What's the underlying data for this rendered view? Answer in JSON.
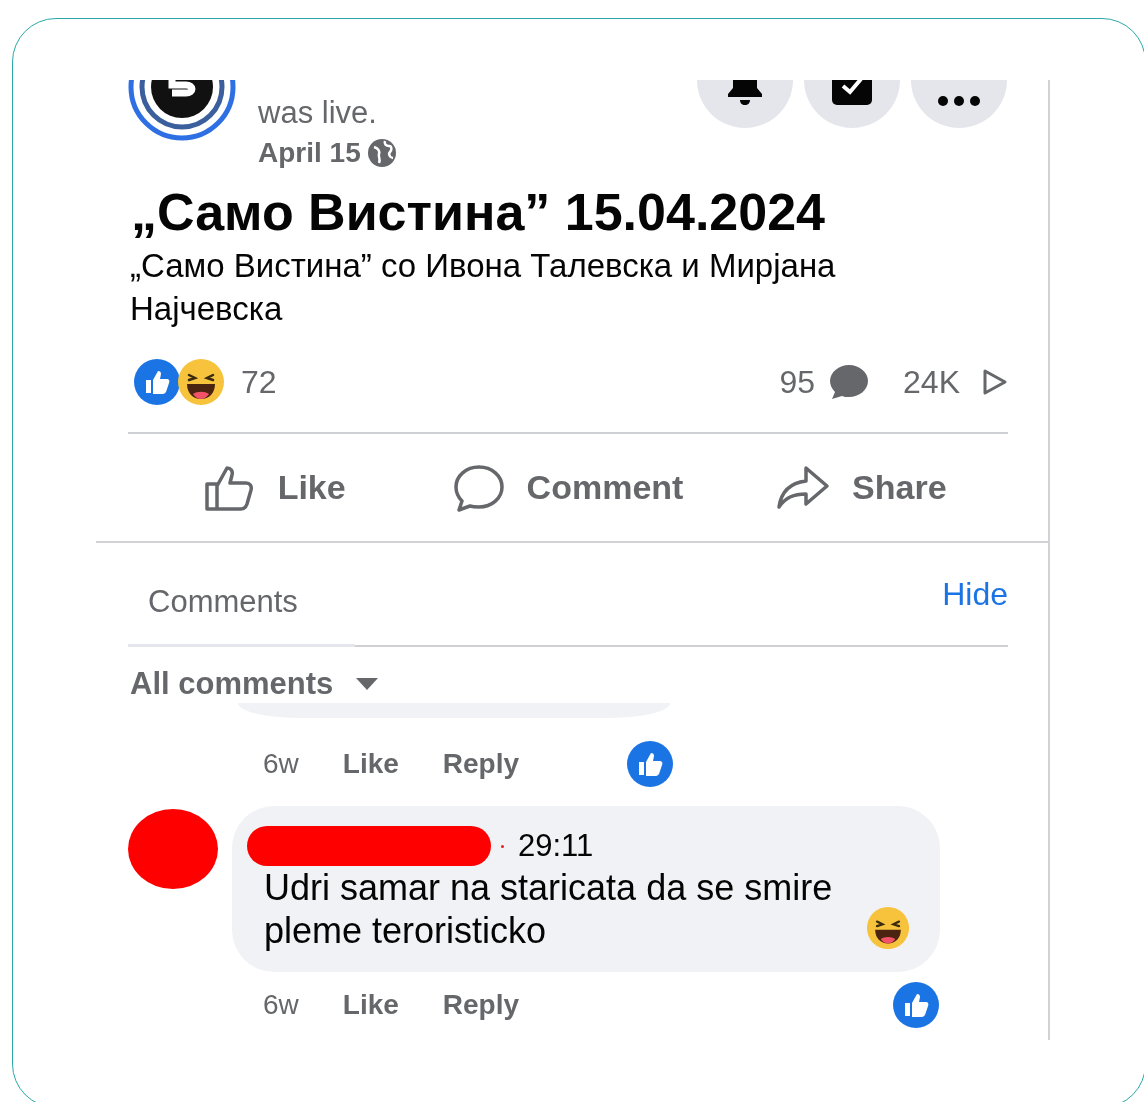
{
  "post": {
    "status": "was live.",
    "date": "April 15",
    "title": "„Само Вистина” 15.04.2024",
    "description": "„Само Вистина” со Ивона Талевска и Мирјана Најчевска"
  },
  "stats": {
    "reactions": "72",
    "comments": "95",
    "views": "24K"
  },
  "actions": [
    {
      "kind": "like",
      "label": "Like"
    },
    {
      "kind": "comment",
      "label": "Comment"
    },
    {
      "kind": "share",
      "label": "Share"
    }
  ],
  "comments_tab": {
    "label": "Comments",
    "selected": true
  },
  "hide_link": "Hide",
  "sort": "All comments",
  "comments": [
    {
      "kind": "partial",
      "age": "6w",
      "like": "Like",
      "reply": "Reply"
    },
    {
      "kind": "full",
      "time": "29:11",
      "text": "Udri samar na staricata da se smire pleme teroristicko",
      "age": "6w",
      "like": "Like",
      "reply": "Reply"
    }
  ]
}
